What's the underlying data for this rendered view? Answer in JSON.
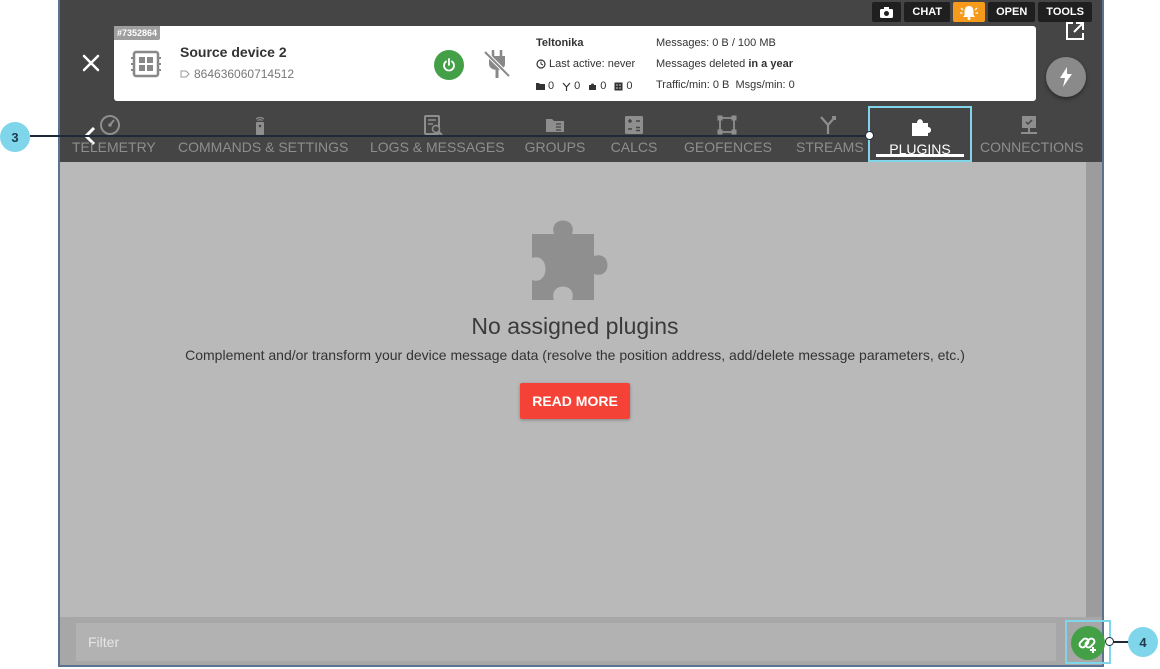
{
  "topbar": {
    "buttons": [
      {
        "icon": "camera-icon",
        "label": ""
      },
      {
        "icon": "",
        "label": "CHAT"
      },
      {
        "icon": "alarm-icon",
        "label": ""
      },
      {
        "icon": "",
        "label": "OPEN"
      },
      {
        "icon": "",
        "label": "TOOLS"
      }
    ]
  },
  "device": {
    "id": "#7352864",
    "name": "Source device 2",
    "imei": "864636060714512",
    "protocol": "Teltonika",
    "last_active": "Last active: never",
    "messages": "Messages: 0 B / 100 MB",
    "messages_deleted_prefix": "Messages deleted ",
    "messages_deleted_value": "in a year",
    "traffic": "Traffic/min: 0 B",
    "msgs_per_min": "Msgs/min: 0",
    "counters": {
      "groups": "0",
      "streams": "0",
      "plugins": "0",
      "calcs": "0"
    }
  },
  "tabs": [
    {
      "label": "TELEMETRY",
      "icon": "gauge-icon"
    },
    {
      "label": "COMMANDS & SETTINGS",
      "icon": "remote-icon"
    },
    {
      "label": "LOGS & MESSAGES",
      "icon": "log-search-icon"
    },
    {
      "label": "GROUPS",
      "icon": "folder-icon"
    },
    {
      "label": "CALCS",
      "icon": "calculator-icon"
    },
    {
      "label": "GEOFENCES",
      "icon": "geofence-icon"
    },
    {
      "label": "STREAMS",
      "icon": "stream-icon"
    },
    {
      "label": "PLUGINS",
      "icon": "puzzle-icon",
      "active": true
    },
    {
      "label": "CONNECTIONS",
      "icon": "connections-icon"
    }
  ],
  "empty": {
    "title": "No assigned plugins",
    "description": "Complement and/or transform your device message data (resolve the position address, add/delete message parameters, etc.)",
    "button": "READ MORE"
  },
  "filter": {
    "placeholder": "Filter"
  },
  "callouts": [
    "3",
    "4"
  ],
  "colors": {
    "accent": "#7fd6ea",
    "green": "#43a047",
    "red": "#f44336",
    "alarm": "#f59a1a"
  }
}
